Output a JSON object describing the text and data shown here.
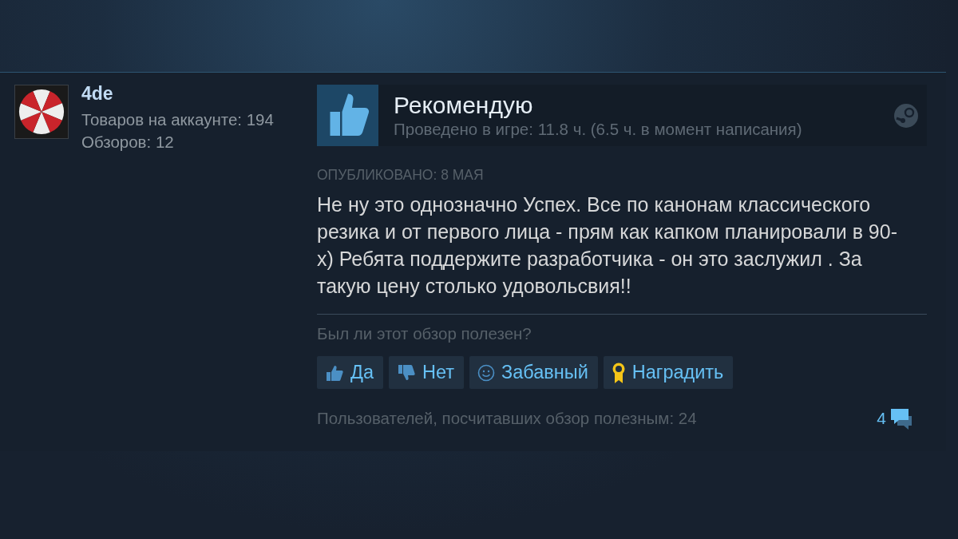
{
  "author": {
    "name": "4de",
    "products": "Товаров на аккаунте: 194",
    "reviews": "Обзоров: 12"
  },
  "verdict": {
    "title": "Рекомендую",
    "hours": "Проведено в игре: 11.8 ч. (6.5 ч. в момент написания)"
  },
  "posted": "ОПУБЛИКОВАНО: 8 МАЯ",
  "body": "Не ну это однозначно Успех. Все по канонам классического резика и от первого лица - прям как капком планировали в 90-х) Ребята поддержите разработчика - он это заслужил . За такую цену столько удовольсвия!!",
  "question": "Был ли этот обзор полезен?",
  "buttons": [
    {
      "kind": "yes",
      "label": "Да"
    },
    {
      "kind": "no",
      "label": "Нет"
    },
    {
      "kind": "funny",
      "label": "Забавный"
    },
    {
      "kind": "award",
      "label": "Наградить"
    }
  ],
  "helpful": "Пользователей, посчитавших обзор полезным: 24",
  "comments": "4"
}
